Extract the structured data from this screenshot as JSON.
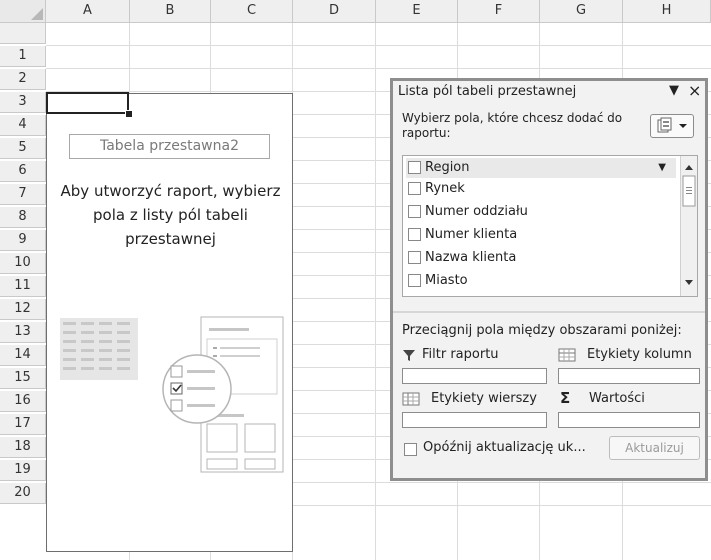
{
  "sheet": {
    "columns": [
      "A",
      "B",
      "C",
      "D",
      "E",
      "F",
      "G",
      "H"
    ],
    "rows": [
      "1",
      "2",
      "3",
      "4",
      "5",
      "6",
      "7",
      "8",
      "9",
      "10",
      "11",
      "12",
      "13",
      "14",
      "15",
      "16",
      "17",
      "18",
      "19",
      "20"
    ]
  },
  "pivot_placeholder": {
    "name": "Tabela przestawna2",
    "instruction": "Aby utworzyć raport, wybierz\npola z listy pól tabeli\nprzestawnej"
  },
  "field_list": {
    "title": "Lista pól tabeli przestawnej",
    "dropdown_glyph": "▼",
    "close_glyph": "×",
    "subtitle": "Wybierz pola, które chcesz dodać do raportu:",
    "fields": [
      "Region",
      "Rynek",
      "Numer oddziału",
      "Numer klienta",
      "Nazwa klienta",
      "Miasto"
    ],
    "drag_hint": "Przeciągnij pola między obszarami poniżej:",
    "areas": {
      "filter": "Filtr raportu",
      "columns": "Etykiety kolumn",
      "rows": "Etykiety wierszy",
      "values": "Wartości"
    },
    "defer_label": "Opóźnij aktualizację uk...",
    "update_label": "Aktualizuj"
  },
  "colors": {
    "header_bg": "#efefef",
    "gridline": "#dcdcdc",
    "pane_bg": "#f2f2f2",
    "pane_border": "#8e8e8e"
  }
}
